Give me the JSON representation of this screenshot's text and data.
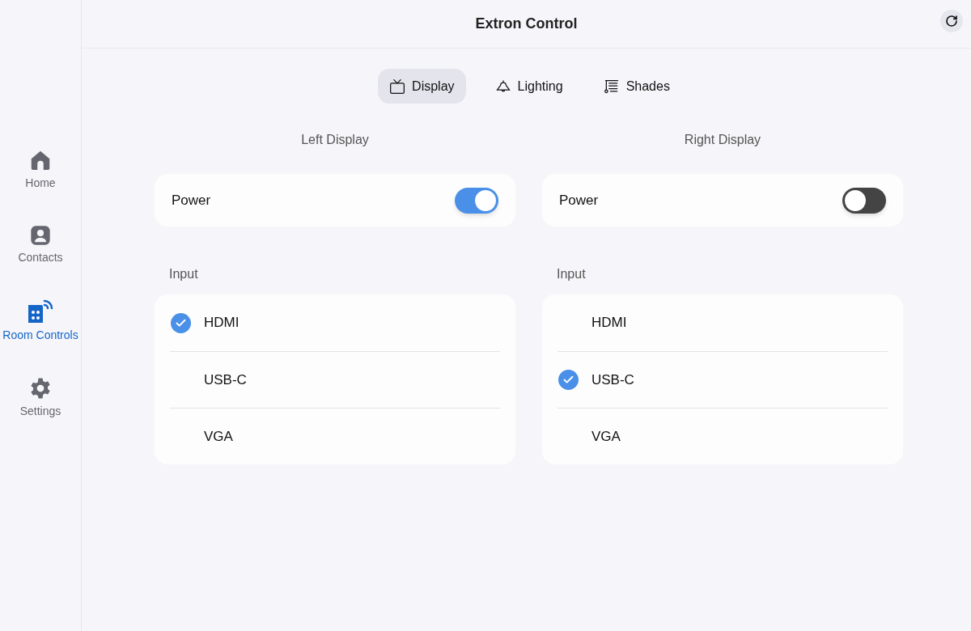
{
  "header": {
    "title": "Extron Control"
  },
  "sidebar": {
    "items": [
      {
        "label": "Home",
        "kind": "home",
        "selected": false
      },
      {
        "label": "Contacts",
        "kind": "contacts",
        "selected": false
      },
      {
        "label": "Room Controls",
        "kind": "room",
        "selected": true
      },
      {
        "label": "Settings",
        "kind": "settings",
        "selected": false
      }
    ]
  },
  "tabs": [
    {
      "label": "Display",
      "kind": "display",
      "selected": true
    },
    {
      "label": "Lighting",
      "kind": "lighting",
      "selected": false
    },
    {
      "label": "Shades",
      "kind": "shades",
      "selected": false
    }
  ],
  "displays": [
    {
      "title": "Left Display",
      "power_label": "Power",
      "on": true,
      "input_label": "Input",
      "inputs": [
        {
          "label": "HDMI",
          "selected": true
        },
        {
          "label": "USB-C",
          "selected": false
        },
        {
          "label": "VGA",
          "selected": false
        }
      ]
    },
    {
      "title": "Right Display",
      "power_label": "Power",
      "on": false,
      "input_label": "Input",
      "inputs": [
        {
          "label": "HDMI",
          "selected": false
        },
        {
          "label": "USB-C",
          "selected": true
        },
        {
          "label": "VGA",
          "selected": false
        }
      ]
    }
  ]
}
